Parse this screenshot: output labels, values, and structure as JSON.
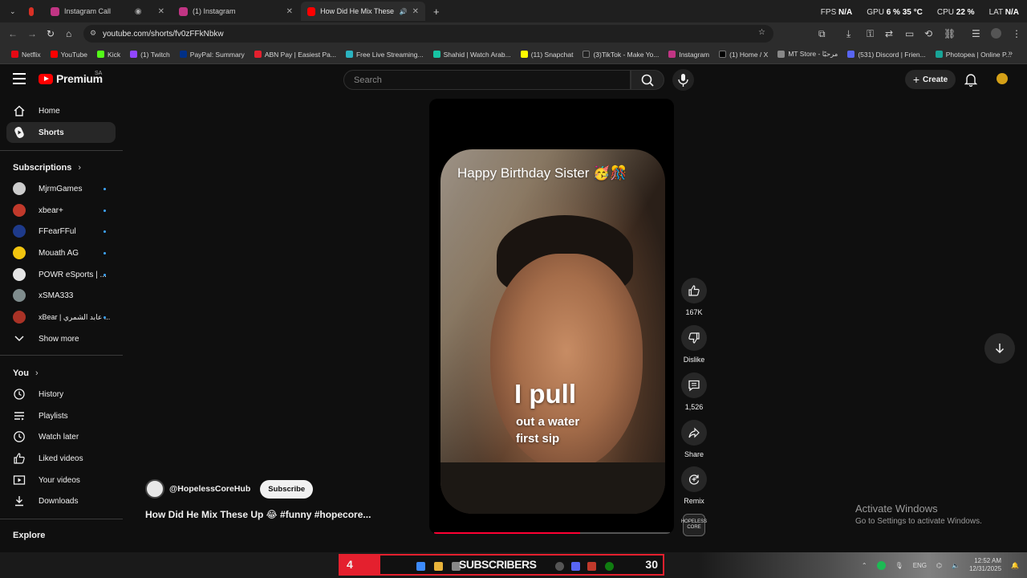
{
  "browser": {
    "tabs": [
      {
        "label": "",
        "color": "#d93025"
      },
      {
        "label": "Instagram Call",
        "color": "#c13584"
      },
      {
        "label": "(1) Instagram",
        "color": "#c13584"
      },
      {
        "label": "How Did He Mix These Up",
        "color": "#ff0000"
      }
    ],
    "perf": {
      "fps_label": "FPS",
      "fps_value": "N/A",
      "gpu_label": "GPU",
      "gpu_value": "6 %",
      "gpu_temp": "35 °C",
      "cpu_label": "CPU",
      "cpu_value": "22 %",
      "lat_label": "LAT",
      "lat_value": "N/A"
    },
    "url": "youtube.com/shorts/fv0zFFkNbkw",
    "bookmarks": [
      {
        "label": "Netflix",
        "color": "#e50914"
      },
      {
        "label": "YouTube",
        "color": "#ff0000"
      },
      {
        "label": "Kick",
        "color": "#53fc18"
      },
      {
        "label": "(1) Twitch",
        "color": "#9146ff"
      },
      {
        "label": "PayPal: Summary",
        "color": "#003087"
      },
      {
        "label": "ABN Pay | Easiest Pa...",
        "color": "#e4202e"
      },
      {
        "label": "Free Live Streaming...",
        "color": "#2bb3c0"
      },
      {
        "label": "Shahid | Watch Arab...",
        "color": "#17c3a3"
      },
      {
        "label": "(11) Snapchat",
        "color": "#fffc00"
      },
      {
        "label": "(3)TikTok - Make Yo...",
        "color": "#222222"
      },
      {
        "label": "Instagram",
        "color": "#c13584"
      },
      {
        "label": "(1) Home / X",
        "color": "#000000"
      },
      {
        "label": "MT Store - مرحبًا",
        "color": "#888888"
      },
      {
        "label": "(531) Discord | Frien...",
        "color": "#5865f2"
      },
      {
        "label": "Photopea | Online P...",
        "color": "#18a497"
      }
    ]
  },
  "header": {
    "brand": "Premium",
    "region": "SA",
    "search_placeholder": "Search",
    "create_label": "Create"
  },
  "sidebar": {
    "main": [
      {
        "label": "Home"
      },
      {
        "label": "Shorts"
      }
    ],
    "subscriptions_title": "Subscriptions",
    "subscriptions": [
      {
        "label": "MjrmGames",
        "color": "#cccccc"
      },
      {
        "label": "xbear+",
        "color": "#c0392b"
      },
      {
        "label": "FFearFFul",
        "color": "#1e3a8a"
      },
      {
        "label": "Mouath AG",
        "color": "#f1c40f"
      },
      {
        "label": "POWR eSports | ...",
        "color": "#e5e5e5"
      },
      {
        "label": "xSMA333",
        "color": "#7f8c8d"
      },
      {
        "label": "xBear | عابد الشمري ...",
        "color": "#a93226"
      }
    ],
    "show_more": "Show more",
    "you_title": "You",
    "you": [
      {
        "label": "History"
      },
      {
        "label": "Playlists"
      },
      {
        "label": "Watch later"
      },
      {
        "label": "Liked videos"
      },
      {
        "label": "Your videos"
      },
      {
        "label": "Downloads"
      }
    ],
    "explore_title": "Explore"
  },
  "short": {
    "overlay_title": "Happy Birthday Sister 🥳🎊",
    "caption_big": "I pull",
    "caption_small": "out a water first sip",
    "progress": 0.62,
    "channel": "@HopelessCoreHub",
    "subscribe_label": "Subscribe",
    "title": "How Did He Mix These Up 😂 #funny #hopecore..."
  },
  "actions": {
    "likes": "167K",
    "dislike": "Dislike",
    "comments": "1,526",
    "share": "Share",
    "remix": "Remix",
    "remix_thumb": "HOPELESS CORE"
  },
  "watermark": {
    "line1": "Activate Windows",
    "line2": "Go to Settings to activate Windows."
  },
  "taskbar": {
    "sub_count": "4",
    "sub_label": "SUBSCRIBERS",
    "sub_right": "30",
    "lang": "ENG",
    "time": "12:52 AM",
    "date": "12/31/2025"
  }
}
